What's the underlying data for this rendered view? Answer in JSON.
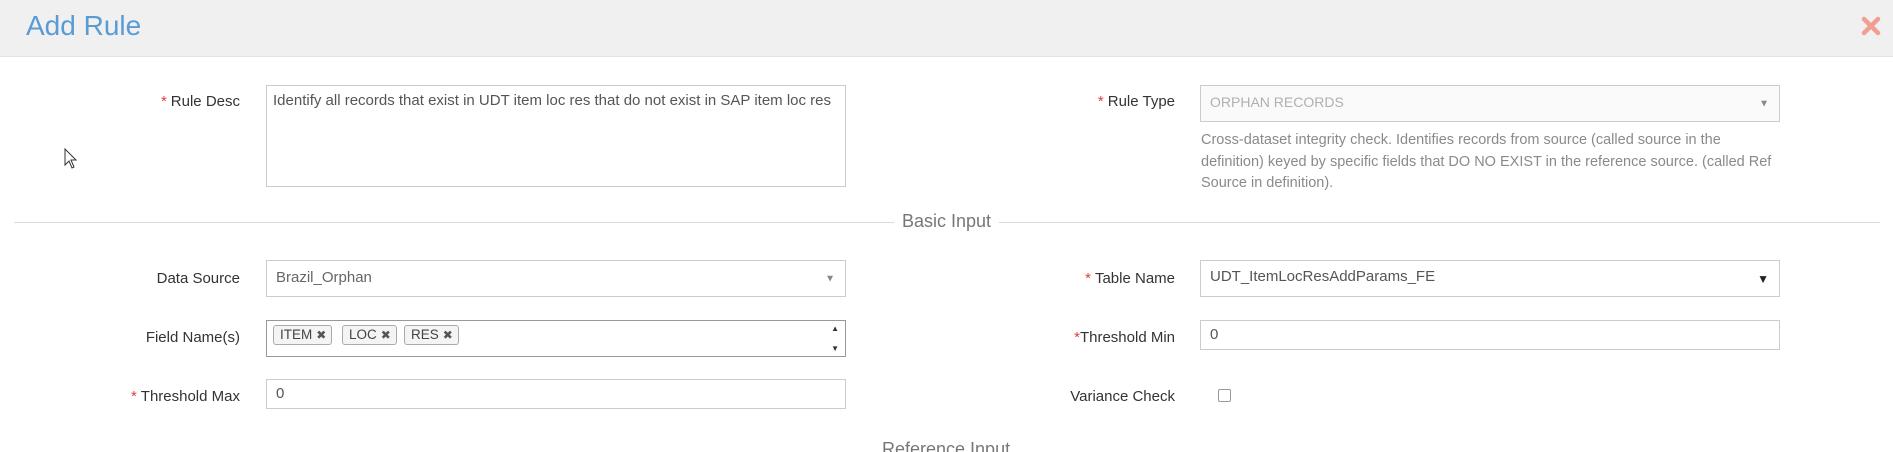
{
  "dialog": {
    "title": "Add Rule"
  },
  "rule_desc": {
    "label": "Rule Desc",
    "required": "*",
    "value": "Identify all records that exist in UDT item loc res that do not exist in SAP item loc res"
  },
  "rule_type": {
    "label": "Rule Type",
    "required": "*",
    "value": "ORPHAN RECORDS",
    "help": "Cross-dataset integrity check. Identifies records from source (called source in the definition) keyed by specific fields that DO NO EXIST in the reference source. (called Ref Source in definition)."
  },
  "sections": {
    "basic": "Basic Input",
    "reference": "Reference Input"
  },
  "data_source": {
    "label": "Data Source",
    "value": "Brazil_Orphan"
  },
  "table_name": {
    "label": "Table Name",
    "required": "*",
    "value": "UDT_ItemLocResAddParams_FE"
  },
  "field_names": {
    "label": "Field Name(s)",
    "tags": [
      "ITEM",
      "LOC",
      "RES"
    ]
  },
  "threshold_min": {
    "label": "Threshold Min",
    "required": "*",
    "value": "0"
  },
  "threshold_max": {
    "label": "Threshold Max",
    "required": "*",
    "value": "0"
  },
  "variance_check": {
    "label": "Variance Check",
    "checked": false
  },
  "colors": {
    "title": "#5b9bd5",
    "required": "#e03c3c",
    "close": "#f0a090"
  },
  "icons": {
    "close": "close-icon",
    "dropdown": "caret-down-icon",
    "tag_remove": "x-icon",
    "cursor": "mouse-pointer-icon"
  }
}
